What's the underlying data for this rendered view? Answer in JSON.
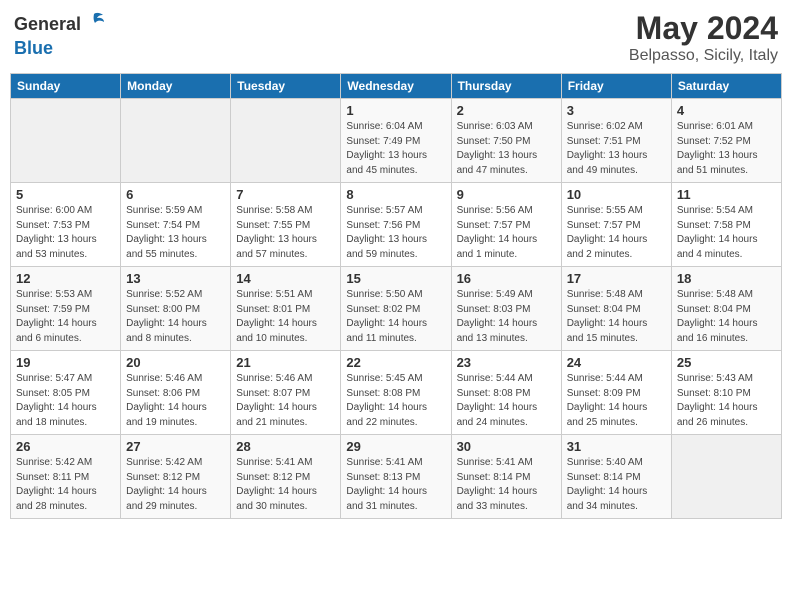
{
  "header": {
    "logo_general": "General",
    "logo_blue": "Blue",
    "month": "May 2024",
    "location": "Belpasso, Sicily, Italy"
  },
  "days_of_week": [
    "Sunday",
    "Monday",
    "Tuesday",
    "Wednesday",
    "Thursday",
    "Friday",
    "Saturday"
  ],
  "weeks": [
    [
      {
        "day": "",
        "info": ""
      },
      {
        "day": "",
        "info": ""
      },
      {
        "day": "",
        "info": ""
      },
      {
        "day": "1",
        "info": "Sunrise: 6:04 AM\nSunset: 7:49 PM\nDaylight: 13 hours\nand 45 minutes."
      },
      {
        "day": "2",
        "info": "Sunrise: 6:03 AM\nSunset: 7:50 PM\nDaylight: 13 hours\nand 47 minutes."
      },
      {
        "day": "3",
        "info": "Sunrise: 6:02 AM\nSunset: 7:51 PM\nDaylight: 13 hours\nand 49 minutes."
      },
      {
        "day": "4",
        "info": "Sunrise: 6:01 AM\nSunset: 7:52 PM\nDaylight: 13 hours\nand 51 minutes."
      }
    ],
    [
      {
        "day": "5",
        "info": "Sunrise: 6:00 AM\nSunset: 7:53 PM\nDaylight: 13 hours\nand 53 minutes."
      },
      {
        "day": "6",
        "info": "Sunrise: 5:59 AM\nSunset: 7:54 PM\nDaylight: 13 hours\nand 55 minutes."
      },
      {
        "day": "7",
        "info": "Sunrise: 5:58 AM\nSunset: 7:55 PM\nDaylight: 13 hours\nand 57 minutes."
      },
      {
        "day": "8",
        "info": "Sunrise: 5:57 AM\nSunset: 7:56 PM\nDaylight: 13 hours\nand 59 minutes."
      },
      {
        "day": "9",
        "info": "Sunrise: 5:56 AM\nSunset: 7:57 PM\nDaylight: 14 hours\nand 1 minute."
      },
      {
        "day": "10",
        "info": "Sunrise: 5:55 AM\nSunset: 7:57 PM\nDaylight: 14 hours\nand 2 minutes."
      },
      {
        "day": "11",
        "info": "Sunrise: 5:54 AM\nSunset: 7:58 PM\nDaylight: 14 hours\nand 4 minutes."
      }
    ],
    [
      {
        "day": "12",
        "info": "Sunrise: 5:53 AM\nSunset: 7:59 PM\nDaylight: 14 hours\nand 6 minutes."
      },
      {
        "day": "13",
        "info": "Sunrise: 5:52 AM\nSunset: 8:00 PM\nDaylight: 14 hours\nand 8 minutes."
      },
      {
        "day": "14",
        "info": "Sunrise: 5:51 AM\nSunset: 8:01 PM\nDaylight: 14 hours\nand 10 minutes."
      },
      {
        "day": "15",
        "info": "Sunrise: 5:50 AM\nSunset: 8:02 PM\nDaylight: 14 hours\nand 11 minutes."
      },
      {
        "day": "16",
        "info": "Sunrise: 5:49 AM\nSunset: 8:03 PM\nDaylight: 14 hours\nand 13 minutes."
      },
      {
        "day": "17",
        "info": "Sunrise: 5:48 AM\nSunset: 8:04 PM\nDaylight: 14 hours\nand 15 minutes."
      },
      {
        "day": "18",
        "info": "Sunrise: 5:48 AM\nSunset: 8:04 PM\nDaylight: 14 hours\nand 16 minutes."
      }
    ],
    [
      {
        "day": "19",
        "info": "Sunrise: 5:47 AM\nSunset: 8:05 PM\nDaylight: 14 hours\nand 18 minutes."
      },
      {
        "day": "20",
        "info": "Sunrise: 5:46 AM\nSunset: 8:06 PM\nDaylight: 14 hours\nand 19 minutes."
      },
      {
        "day": "21",
        "info": "Sunrise: 5:46 AM\nSunset: 8:07 PM\nDaylight: 14 hours\nand 21 minutes."
      },
      {
        "day": "22",
        "info": "Sunrise: 5:45 AM\nSunset: 8:08 PM\nDaylight: 14 hours\nand 22 minutes."
      },
      {
        "day": "23",
        "info": "Sunrise: 5:44 AM\nSunset: 8:08 PM\nDaylight: 14 hours\nand 24 minutes."
      },
      {
        "day": "24",
        "info": "Sunrise: 5:44 AM\nSunset: 8:09 PM\nDaylight: 14 hours\nand 25 minutes."
      },
      {
        "day": "25",
        "info": "Sunrise: 5:43 AM\nSunset: 8:10 PM\nDaylight: 14 hours\nand 26 minutes."
      }
    ],
    [
      {
        "day": "26",
        "info": "Sunrise: 5:42 AM\nSunset: 8:11 PM\nDaylight: 14 hours\nand 28 minutes."
      },
      {
        "day": "27",
        "info": "Sunrise: 5:42 AM\nSunset: 8:12 PM\nDaylight: 14 hours\nand 29 minutes."
      },
      {
        "day": "28",
        "info": "Sunrise: 5:41 AM\nSunset: 8:12 PM\nDaylight: 14 hours\nand 30 minutes."
      },
      {
        "day": "29",
        "info": "Sunrise: 5:41 AM\nSunset: 8:13 PM\nDaylight: 14 hours\nand 31 minutes."
      },
      {
        "day": "30",
        "info": "Sunrise: 5:41 AM\nSunset: 8:14 PM\nDaylight: 14 hours\nand 33 minutes."
      },
      {
        "day": "31",
        "info": "Sunrise: 5:40 AM\nSunset: 8:14 PM\nDaylight: 14 hours\nand 34 minutes."
      },
      {
        "day": "",
        "info": ""
      }
    ]
  ]
}
